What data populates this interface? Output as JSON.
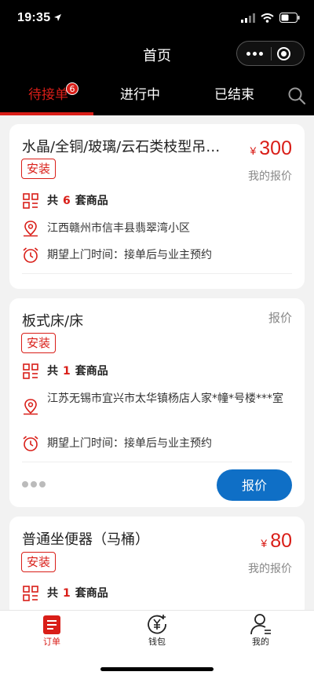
{
  "status_bar": {
    "time": "19:35"
  },
  "nav": {
    "title": "首页"
  },
  "tabs": [
    {
      "label": "待接单",
      "badge": "6",
      "active": true
    },
    {
      "label": "进行中"
    },
    {
      "label": "已结束"
    }
  ],
  "orders": [
    {
      "title": "水晶/全铜/玻璃/云石类枝型吊灯…",
      "price_symbol": "¥",
      "price": "300",
      "price_label": "我的报价",
      "tag": "安装",
      "count_prefix": "共",
      "count": "6",
      "count_suffix": "套商品",
      "address": "江西赣州市信丰县翡翠湾小区",
      "visit_time": "期望上门时间：接单后与业主预约"
    },
    {
      "title": "板式床/床",
      "price_label": "报价",
      "tag": "安装",
      "count_prefix": "共",
      "count": "1",
      "count_suffix": "套商品",
      "address": "江苏无锡市宜兴市太华镇杨店人家*幢*号楼***室",
      "visit_time": "期望上门时间：接单后与业主预约",
      "quote_button": "报价"
    },
    {
      "title": "普通坐便器（马桶）",
      "price_symbol": "¥",
      "price": "80",
      "price_label": "我的报价",
      "tag": "安装",
      "count_prefix": "共",
      "count": "1",
      "count_suffix": "套商品"
    }
  ],
  "bottom_tabs": [
    {
      "label": "订单",
      "icon": "order-icon",
      "active": true
    },
    {
      "label": "钱包",
      "icon": "wallet-icon"
    },
    {
      "label": "我的",
      "icon": "profile-icon"
    }
  ],
  "colors": {
    "accent": "#d91e18",
    "button": "#0f6fc6"
  }
}
